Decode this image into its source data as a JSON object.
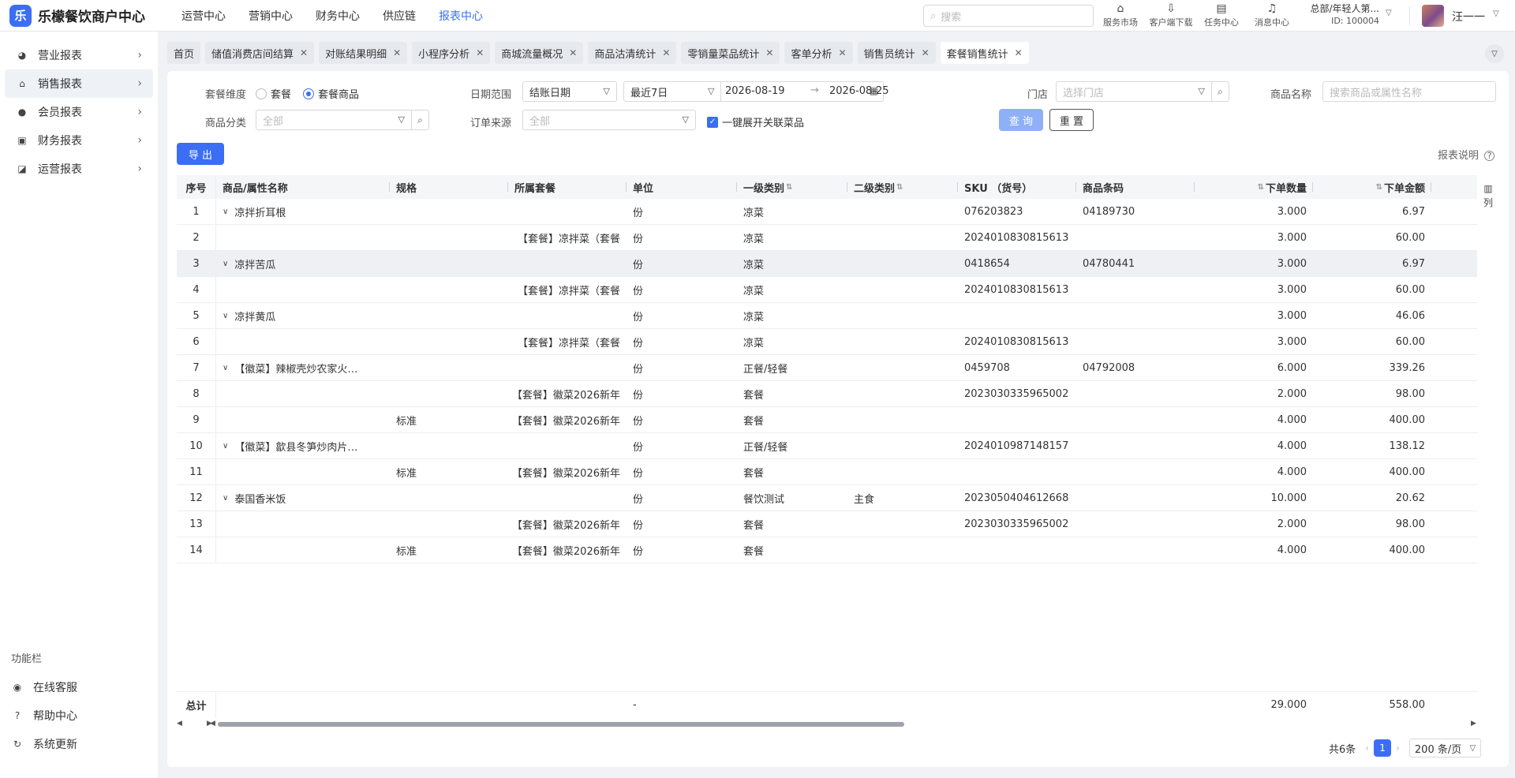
{
  "app": {
    "logo_char": "乐",
    "title": "乐檬餐饮商户中心"
  },
  "topnav": [
    "运营中心",
    "营销中心",
    "财务中心",
    "供应链",
    "报表中心"
  ],
  "search": {
    "placeholder": "搜索"
  },
  "tools": [
    {
      "icon": "store-icon",
      "glyph": "⌂",
      "label": "服务市场"
    },
    {
      "icon": "download-icon",
      "glyph": "⇩",
      "label": "客户端下载"
    },
    {
      "icon": "clipboard-icon",
      "glyph": "▤",
      "label": "任务中心"
    },
    {
      "icon": "bell-icon",
      "glyph": "♫",
      "label": "消息中心"
    }
  ],
  "org": {
    "name": "总部/年轻人第...",
    "id": "ID: 100004"
  },
  "user": {
    "name": "汪一一"
  },
  "sidebar": {
    "items": [
      {
        "label": "营业报表",
        "glyph": "◕",
        "icon": "chart-pie-icon"
      },
      {
        "label": "销售报表",
        "glyph": "⌂",
        "icon": "bank-icon"
      },
      {
        "label": "会员报表",
        "glyph": "●",
        "icon": "user-icon"
      },
      {
        "label": "财务报表",
        "glyph": "▣",
        "icon": "ledger-icon"
      },
      {
        "label": "运营报表",
        "glyph": "◪",
        "icon": "operations-icon"
      }
    ],
    "bottom_title": "功能栏",
    "bottom_items": [
      {
        "label": "在线客服",
        "glyph": "◉",
        "icon": "headset-icon"
      },
      {
        "label": "帮助中心",
        "glyph": "?",
        "icon": "help-icon"
      },
      {
        "label": "系统更新",
        "glyph": "↻",
        "icon": "refresh-icon"
      }
    ]
  },
  "tabs": [
    "首页",
    "储值消费店间结算",
    "对账结果明细",
    "小程序分析",
    "商城流量概况",
    "商品沽清统计",
    "零销量菜品统计",
    "客单分析",
    "销售员统计",
    "套餐销售统计"
  ],
  "filters": {
    "dimension_label": "套餐维度",
    "dimension_opt1": "套餐",
    "dimension_opt2": "套餐商品",
    "date_label": "日期范围",
    "date_type": "结账日期",
    "date_preset": "最近7日",
    "date_start": "2026-08-19",
    "date_end": "2026-08-25",
    "store_label": "门店",
    "store_placeholder": "选择门店",
    "product_label": "商品名称",
    "product_placeholder": "搜索商品或属性名称",
    "category_label": "商品分类",
    "category_placeholder": "全部",
    "source_label": "订单来源",
    "source_placeholder": "全部",
    "expand_label": "一键展开关联菜品",
    "query_label": "查 询",
    "reset_label": "重 置",
    "export_label": "导 出",
    "report_note": "报表说明"
  },
  "table": {
    "headers": [
      "序号",
      "商品/属性名称",
      "规格",
      "所属套餐",
      "单位",
      "一级类别",
      "二级类别",
      "SKU （货号）",
      "商品条码",
      "下单数量",
      "下单金额"
    ],
    "col_settings": "列",
    "rows": [
      {
        "idx": "1",
        "name": "凉拌折耳根",
        "expand": true,
        "spec": "",
        "pkg": "",
        "unit": "份",
        "cat1": "凉菜",
        "cat2": "",
        "sku": "076203823",
        "barcode": "04189730",
        "qty": "3.000",
        "amt": "6.97"
      },
      {
        "idx": "2",
        "name": "",
        "expand": false,
        "spec": "",
        "pkg": "【套餐】凉拌菜（套餐",
        "unit": "份",
        "cat1": "凉菜",
        "cat2": "",
        "sku": "2024010830815613",
        "barcode": "",
        "qty": "3.000",
        "amt": "60.00"
      },
      {
        "idx": "3",
        "name": "凉拌苦瓜",
        "expand": true,
        "spec": "",
        "pkg": "",
        "unit": "份",
        "cat1": "凉菜",
        "cat2": "",
        "sku": "0418654",
        "barcode": "04780441",
        "qty": "3.000",
        "amt": "6.97"
      },
      {
        "idx": "4",
        "name": "",
        "expand": false,
        "spec": "",
        "pkg": "【套餐】凉拌菜（套餐",
        "unit": "份",
        "cat1": "凉菜",
        "cat2": "",
        "sku": "2024010830815613",
        "barcode": "",
        "qty": "3.000",
        "amt": "60.00"
      },
      {
        "idx": "5",
        "name": "凉拌黄瓜",
        "expand": true,
        "spec": "",
        "pkg": "",
        "unit": "份",
        "cat1": "凉菜",
        "cat2": "",
        "sku": "",
        "barcode": "",
        "qty": "3.000",
        "amt": "46.06"
      },
      {
        "idx": "6",
        "name": "",
        "expand": false,
        "spec": "",
        "pkg": "【套餐】凉拌菜（套餐",
        "unit": "份",
        "cat1": "凉菜",
        "cat2": "",
        "sku": "2024010830815613",
        "barcode": "",
        "qty": "3.000",
        "amt": "60.00"
      },
      {
        "idx": "7",
        "name": "【徽菜】辣椒壳炒农家火…",
        "expand": true,
        "spec": "",
        "pkg": "",
        "unit": "份",
        "cat1": "正餐/轻餐",
        "cat2": "",
        "sku": "0459708",
        "barcode": "04792008",
        "qty": "6.000",
        "amt": "339.26"
      },
      {
        "idx": "8",
        "name": "",
        "expand": false,
        "spec": "",
        "pkg": "【套餐】徽菜2026新年",
        "unit": "份",
        "cat1": "套餐",
        "cat2": "",
        "sku": "2023030335965002",
        "barcode": "",
        "qty": "2.000",
        "amt": "98.00"
      },
      {
        "idx": "9",
        "name": "",
        "expand": false,
        "spec": "标准",
        "pkg": "【套餐】徽菜2026新年",
        "unit": "份",
        "cat1": "套餐",
        "cat2": "",
        "sku": "",
        "barcode": "",
        "qty": "4.000",
        "amt": "400.00"
      },
      {
        "idx": "10",
        "name": "【徽菜】歙县冬笋炒肉片…",
        "expand": true,
        "spec": "",
        "pkg": "",
        "unit": "份",
        "cat1": "正餐/轻餐",
        "cat2": "",
        "sku": "2024010987148157",
        "barcode": "",
        "qty": "4.000",
        "amt": "138.12"
      },
      {
        "idx": "11",
        "name": "",
        "expand": false,
        "spec": "标准",
        "pkg": "【套餐】徽菜2026新年",
        "unit": "份",
        "cat1": "套餐",
        "cat2": "",
        "sku": "",
        "barcode": "",
        "qty": "4.000",
        "amt": "400.00"
      },
      {
        "idx": "12",
        "name": "泰国香米饭",
        "expand": true,
        "spec": "",
        "pkg": "",
        "unit": "份",
        "cat1": "餐饮测试",
        "cat2": "主食",
        "sku": "2023050404612668",
        "barcode": "",
        "qty": "10.000",
        "amt": "20.62"
      },
      {
        "idx": "13",
        "name": "",
        "expand": false,
        "spec": "",
        "pkg": "【套餐】徽菜2026新年",
        "unit": "份",
        "cat1": "套餐",
        "cat2": "",
        "sku": "2023030335965002",
        "barcode": "",
        "qty": "2.000",
        "amt": "98.00"
      },
      {
        "idx": "14",
        "name": "",
        "expand": false,
        "spec": "标准",
        "pkg": "【套餐】徽菜2026新年",
        "unit": "份",
        "cat1": "套餐",
        "cat2": "",
        "sku": "",
        "barcode": "",
        "qty": "4.000",
        "amt": "400.00"
      }
    ],
    "highlight_row": 2,
    "total": {
      "label": "总计",
      "unit": "-",
      "qty": "29.000",
      "amt": "558.00"
    },
    "scroll_position": 0.55
  },
  "pager": {
    "total": "共6条",
    "page": "1",
    "size": "200 条/页"
  },
  "colors": {
    "accent": "#3b6ef5",
    "query_button": "#8fb0f7",
    "page_bg": "#f0f2f5"
  }
}
